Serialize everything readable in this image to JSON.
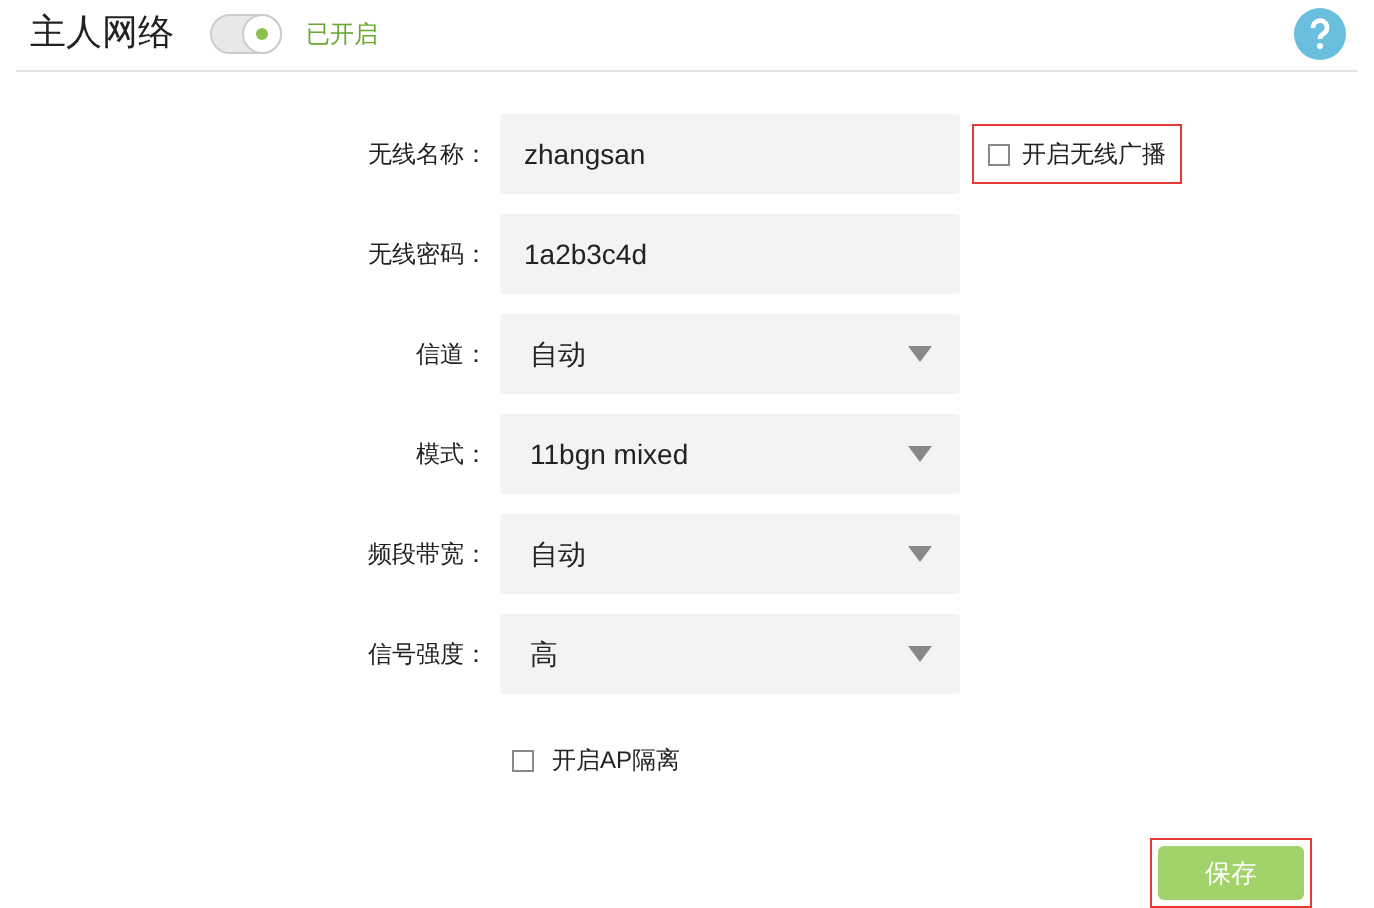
{
  "header": {
    "title": "主人网络",
    "switch": {
      "on": true
    },
    "status": "已开启"
  },
  "fields": [
    {
      "kind": "text",
      "label": "无线名称：",
      "value": "zhangsan"
    },
    {
      "kind": "text",
      "label": "无线密码：",
      "value": "1a2b3c4d"
    },
    {
      "kind": "select",
      "label": "信道：",
      "value": "自动"
    },
    {
      "kind": "select",
      "label": "模式：",
      "value": "11bgn mixed"
    },
    {
      "kind": "select",
      "label": "频段带宽：",
      "value": "自动"
    },
    {
      "kind": "select",
      "label": "信号强度：",
      "value": "高"
    }
  ],
  "broadcast": {
    "label": "开启无线广播",
    "checked": false,
    "highlighted": true
  },
  "ap_isolation": {
    "label": "开启AP隔离",
    "checked": false
  },
  "save": {
    "label": "保存",
    "highlighted": true
  }
}
